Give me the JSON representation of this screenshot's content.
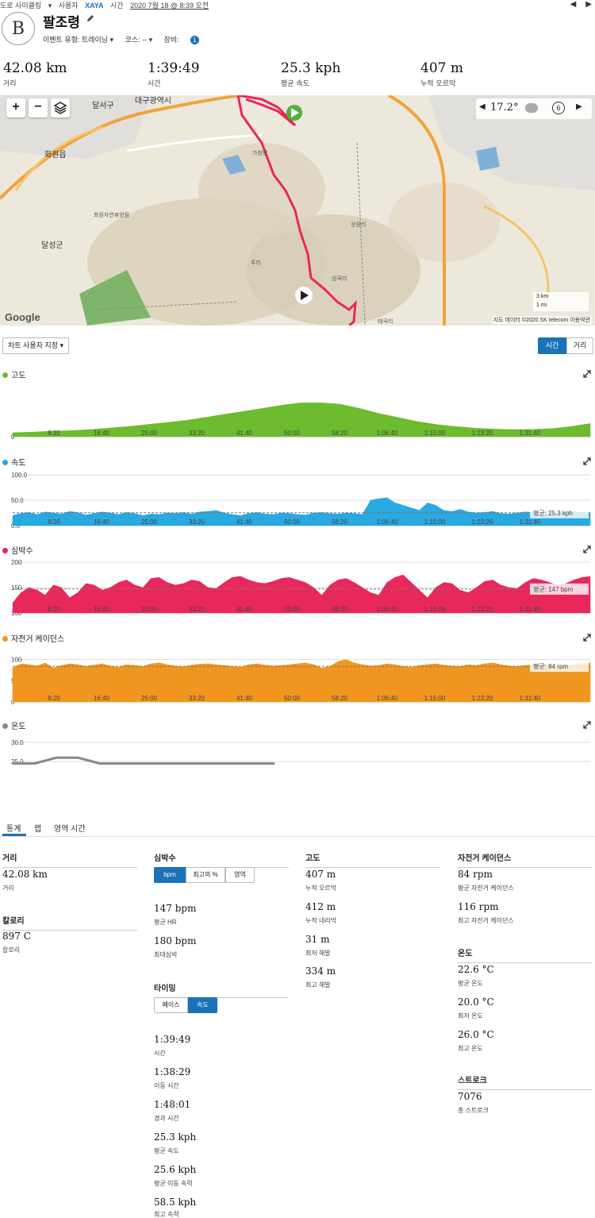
{
  "topline": {
    "activity_type": "도로 사이클링",
    "dropdown_icon": "chevron-down-icon",
    "by_label": "사용자",
    "user": "XAYA",
    "time_label": "시간",
    "datetime": "2020 7월 18 @ 8:39 오전"
  },
  "header": {
    "avatar_letter": "B",
    "title": "팔조령",
    "event_type": "이벤트 유형: 트레이닝 ▾",
    "course": "코스: -- ▾",
    "gear_label": "장비:",
    "gear_count": "1"
  },
  "summary": [
    {
      "value": "42.08 km",
      "label": "거리"
    },
    {
      "value": "1:39:49",
      "label": "시간"
    },
    {
      "value": "25.3 kph",
      "label": "평균 속도"
    },
    {
      "value": "407 m",
      "label": "누적 오르막"
    }
  ],
  "map": {
    "zoom_in": "+",
    "zoom_out": "−",
    "temperature": "17.2°",
    "weather_wind": "6",
    "google": "Google",
    "credit": "지도 데이터 ©2020 SK telecom   이용약관",
    "scale_km": "3 km",
    "scale_mi": "1 mi",
    "places": {
      "daegu": "대구광역시",
      "dalseo": "달서구",
      "hwawon": "화원읍",
      "dalseong": "달성군",
      "park": "화원자연휴양림",
      "gachang": "가창면",
      "seonggok": "성곡리",
      "sangwon": "상원리",
      "juri": "주리",
      "daegong": "태곡리"
    }
  },
  "chart_controls": {
    "custom": "차트 사용자 지정 ▾",
    "time": "시간",
    "distance": "거리"
  },
  "chart_data": [
    {
      "type": "area",
      "title": "고도",
      "color": "#6dbb2f",
      "x_ticks": [
        "8:20",
        "16:40",
        "25:00",
        "33:20",
        "41:40",
        "50:00",
        "58:20",
        "1:06:40",
        "1:15:00",
        "1:23:20",
        "1:31:40"
      ],
      "y_ticks": [
        "0"
      ],
      "ylim": [
        0,
        500
      ],
      "series": [
        {
          "values": [
            40,
            45,
            55,
            60,
            70,
            85,
            100,
            120,
            140,
            160,
            190,
            220,
            250,
            280,
            310,
            334,
            334,
            320,
            280,
            230,
            190,
            150,
            120,
            100,
            85,
            75,
            70,
            72,
            80,
            100,
            130
          ]
        }
      ]
    },
    {
      "type": "area",
      "title": "속도",
      "color": "#2aa8e0",
      "x_ticks": [
        "8:20",
        "16:40",
        "25:00",
        "33:20",
        "41:40",
        "50:00",
        "58:20",
        "1:06:40",
        "1:15:00",
        "1:23:20",
        "1:31:40"
      ],
      "y_ticks": [
        "0.0",
        "50.0",
        "100.0"
      ],
      "ylim": [
        0,
        100
      ],
      "avg_label": "평균: 25.3 kph",
      "avg": 25.3,
      "series": [
        {
          "values": [
            20,
            24,
            26,
            22,
            27,
            25,
            23,
            28,
            26,
            21,
            24,
            27,
            25,
            22,
            26,
            24,
            20,
            23,
            22,
            25,
            24,
            26,
            23,
            27,
            28,
            30,
            25,
            22,
            20,
            24,
            26,
            23,
            22,
            25,
            24,
            22,
            21,
            25,
            26,
            24,
            23,
            25,
            24,
            22,
            50,
            53,
            55,
            45,
            40,
            35,
            30,
            45,
            40,
            30,
            28,
            32,
            27,
            25,
            26,
            28,
            24,
            23,
            25,
            27,
            26,
            22,
            24,
            25,
            27,
            28,
            26,
            25
          ]
        }
      ]
    },
    {
      "type": "area",
      "title": "심박수",
      "color": "#e8285a",
      "x_ticks": [
        "8:20",
        "16:40",
        "25:00",
        "33:20",
        "41:40",
        "50:00",
        "58:20",
        "1:06:40",
        "1:15:00",
        "1:23:20",
        "1:31:40"
      ],
      "y_ticks": [
        "100",
        "150",
        "200"
      ],
      "ylim": [
        100,
        200
      ],
      "avg_label": "평균: 147 bpm",
      "avg": 147,
      "series": [
        {
          "values": [
            120,
            140,
            150,
            145,
            135,
            155,
            150,
            130,
            140,
            158,
            155,
            145,
            150,
            160,
            165,
            155,
            150,
            168,
            170,
            160,
            155,
            158,
            165,
            162,
            150,
            148,
            160,
            170,
            172,
            165,
            160,
            158,
            162,
            168,
            170,
            165,
            160,
            150,
            135,
            155,
            165,
            168,
            160,
            150,
            140,
            135,
            160,
            170,
            175,
            160,
            145,
            130,
            150,
            160,
            158,
            145,
            140,
            150,
            162,
            165,
            155,
            150,
            148,
            160,
            168,
            165,
            160,
            155,
            158,
            165,
            170,
            172
          ]
        }
      ]
    },
    {
      "type": "area",
      "title": "자전거 케이던스",
      "color": "#f0961e",
      "x_ticks": [
        "8:20",
        "16:40",
        "25:00",
        "33:20",
        "41:40",
        "50:00",
        "58:20",
        "1:06:40",
        "1:15:00",
        "1:23:20",
        "1:31:40"
      ],
      "y_ticks": [
        "0",
        "50",
        "100"
      ],
      "ylim": [
        0,
        120
      ],
      "avg_label": "평균: 84 rpm",
      "avg": 84,
      "series": [
        {
          "values": [
            80,
            90,
            88,
            85,
            92,
            80,
            86,
            90,
            88,
            84,
            87,
            90,
            85,
            82,
            88,
            86,
            84,
            90,
            92,
            88,
            85,
            83,
            87,
            89,
            90,
            88,
            86,
            84,
            82,
            88,
            90,
            87,
            85,
            86,
            88,
            90,
            92,
            88,
            80,
            84,
            95,
            100,
            92,
            88,
            85,
            86,
            90,
            88,
            84,
            82,
            86,
            88,
            90,
            87,
            85,
            84,
            88,
            86,
            90,
            92,
            88,
            85,
            84,
            86,
            88,
            90,
            87,
            85,
            86,
            88,
            90,
            92
          ]
        }
      ]
    },
    {
      "type": "line",
      "title": "온도",
      "color": "#888888",
      "x_ticks": [],
      "y_ticks": [
        "25.0",
        "30.0"
      ],
      "ylim": [
        24,
        31
      ],
      "series": [
        {
          "values": [
            24.5,
            24.5,
            26,
            26,
            24.5,
            24.5,
            24.5,
            24.5,
            24.5,
            24.5,
            24.5,
            24.5,
            24.5
          ]
        }
      ]
    }
  ],
  "tabs": {
    "stats": "통계",
    "laps": "랩",
    "zone": "영역 시간"
  },
  "stats": {
    "distance": {
      "head": "거리",
      "value": "42.08 km",
      "label": "거리"
    },
    "calories": {
      "head": "칼로리",
      "value": "897 C",
      "label": "칼로리"
    },
    "hr": {
      "head": "심박수",
      "seg": [
        "bpm",
        "최고의 %",
        "영역"
      ],
      "avg": {
        "value": "147 bpm",
        "label": "평균 HR"
      },
      "max": {
        "value": "180 bpm",
        "label": "최대심박"
      }
    },
    "timing": {
      "head": "타이밍",
      "seg": [
        "페이스",
        "속도"
      ],
      "rows": [
        {
          "value": "1:39:49",
          "label": "시간"
        },
        {
          "value": "1:38:29",
          "label": "이동 시간"
        },
        {
          "value": "1:48:01",
          "label": "경과 시간"
        },
        {
          "value": "25.3 kph",
          "label": "평균 속도"
        },
        {
          "value": "25.6 kph",
          "label": "평균 이동 속력"
        },
        {
          "value": "58.5 kph",
          "label": "최고 속력"
        }
      ]
    },
    "elevation": {
      "head": "고도",
      "rows": [
        {
          "value": "407 m",
          "label": "누적 오르막"
        },
        {
          "value": "412 m",
          "label": "누적 내리막"
        },
        {
          "value": "31 m",
          "label": "최저 해발"
        },
        {
          "value": "334 m",
          "label": "최고 해발"
        }
      ]
    },
    "cadence": {
      "head": "자전거 케이던스",
      "rows": [
        {
          "value": "84 rpm",
          "label": "평균 자전거 케이던스"
        },
        {
          "value": "116 rpm",
          "label": "최고 자전거 케이던스"
        }
      ]
    },
    "temperature": {
      "head": "온도",
      "rows": [
        {
          "value": "22.6 °C",
          "label": "평균 온도"
        },
        {
          "value": "20.0 °C",
          "label": "최저 온도"
        },
        {
          "value": "26.0 °C",
          "label": "최고 온도"
        }
      ]
    },
    "strokes": {
      "head": "스트로크",
      "value": "7076",
      "label": "총 스트로크"
    }
  }
}
